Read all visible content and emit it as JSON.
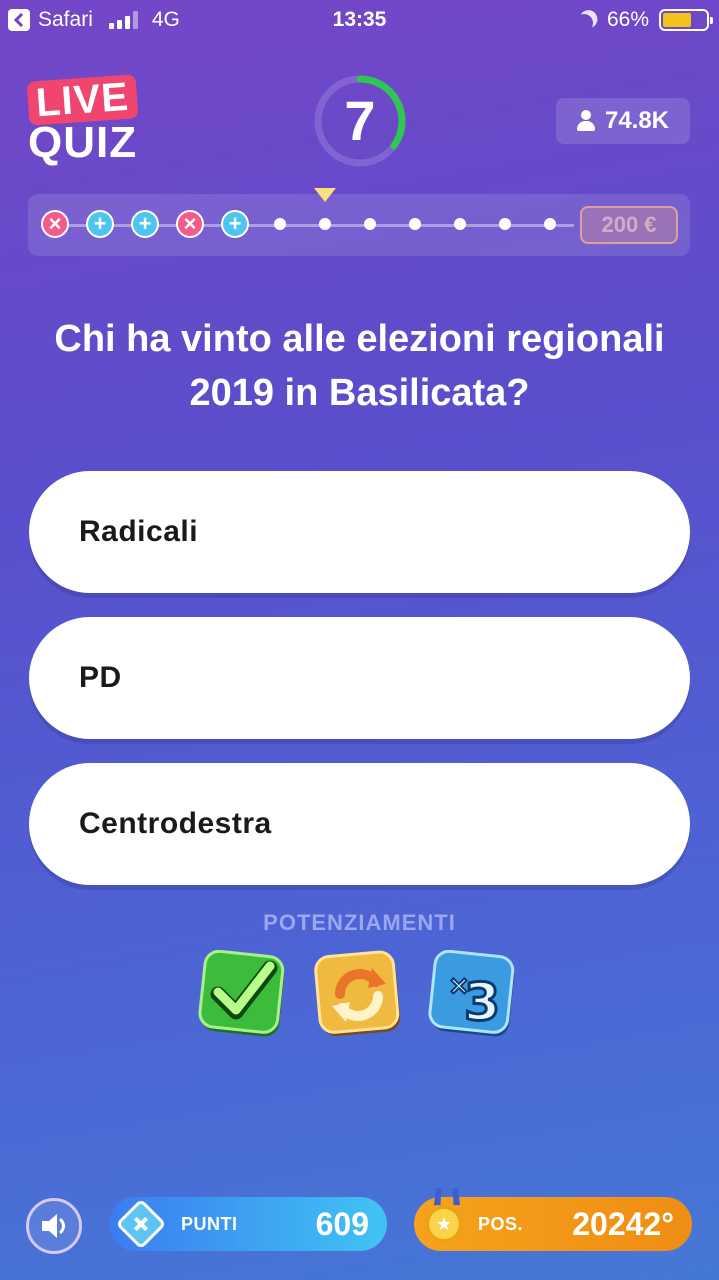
{
  "status_bar": {
    "back_app": "Safari",
    "network": "4G",
    "time": "13:35",
    "battery": "66%",
    "battery_level": 0.66
  },
  "header": {
    "logo_top": "LIVE",
    "logo_bottom": "QUIZ",
    "timer_value": "7",
    "timer_remaining_fraction": 0.35,
    "players": "74.8K"
  },
  "progress": {
    "steps": [
      "wrong",
      "right",
      "right",
      "wrong",
      "right",
      "pending",
      "pending",
      "pending",
      "pending",
      "pending",
      "pending",
      "pending"
    ],
    "current_step": 6,
    "prize": "200 €"
  },
  "question": {
    "text": "Chi ha vinto alle elezioni regionali 2019 in Basilicata?",
    "answers": [
      "Radicali",
      "PD",
      "Centrodestra"
    ]
  },
  "powerups": {
    "title": "POTENZIAMENTI",
    "items": [
      "check-icon",
      "refresh-icon",
      "times-three-icon"
    ]
  },
  "footer": {
    "punti_label": "PUNTI",
    "punti_value": "609",
    "pos_label": "POS.",
    "pos_value": "20242°"
  },
  "colors": {
    "wrong": "#f25c8a",
    "right": "#4ec5f0",
    "timer": "#2fc653",
    "punti": "#3b7cf0",
    "pos": "#f6a21c"
  }
}
